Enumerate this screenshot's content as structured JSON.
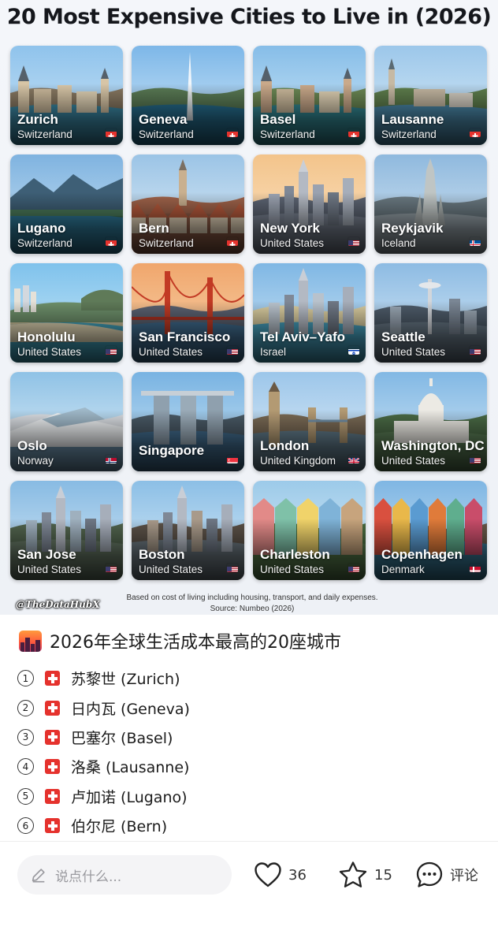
{
  "infographic": {
    "title": "20 Most Expensive Cities to Live in (2026)",
    "watermark": "@TheDataHubX",
    "note_line1": "Based on cost of living including housing, transport, and daily expenses.",
    "note_line2": "Source: Numbeo (2026)",
    "cities": [
      {
        "city": "Zurich",
        "country": "Switzerland",
        "flag": "switzerland-flag-icon"
      },
      {
        "city": "Geneva",
        "country": "Switzerland",
        "flag": "switzerland-flag-icon"
      },
      {
        "city": "Basel",
        "country": "Switzerland",
        "flag": "switzerland-flag-icon"
      },
      {
        "city": "Lausanne",
        "country": "Switzerland",
        "flag": "switzerland-flag-icon"
      },
      {
        "city": "Lugano",
        "country": "Switzerland",
        "flag": "switzerland-flag-icon"
      },
      {
        "city": "Bern",
        "country": "Switzerland",
        "flag": "switzerland-flag-icon"
      },
      {
        "city": "New York",
        "country": "United States",
        "flag": "usa-flag-icon"
      },
      {
        "city": "Reykjavik",
        "country": "Iceland",
        "flag": "iceland-flag-icon"
      },
      {
        "city": "Honolulu",
        "country": "United States",
        "flag": "usa-flag-icon"
      },
      {
        "city": "San Francisco",
        "country": "United States",
        "flag": "usa-flag-icon"
      },
      {
        "city": "Tel Aviv–Yafo",
        "country": "Israel",
        "flag": "israel-flag-icon"
      },
      {
        "city": "Seattle",
        "country": "United States",
        "flag": "usa-flag-icon"
      },
      {
        "city": "Oslo",
        "country": "Norway",
        "flag": "norway-flag-icon"
      },
      {
        "city": "Singapore",
        "country": "",
        "flag": "singapore-flag-icon"
      },
      {
        "city": "London",
        "country": "United Kingdom",
        "flag": "uk-flag-icon"
      },
      {
        "city": "Washington, DC",
        "country": "United States",
        "flag": "usa-flag-icon"
      },
      {
        "city": "San Jose",
        "country": "United States",
        "flag": "usa-flag-icon"
      },
      {
        "city": "Boston",
        "country": "United States",
        "flag": "usa-flag-icon"
      },
      {
        "city": "Charleston",
        "country": "United States",
        "flag": "usa-flag-icon"
      },
      {
        "city": "Copenhagen",
        "country": "Denmark",
        "flag": "denmark-flag-icon"
      }
    ]
  },
  "post": {
    "title_icon": "cityscape-emoji-icon",
    "title": "2026年全球生活成本最高的20座城市",
    "list": [
      {
        "num": "1",
        "text": "苏黎世 (Zurich)"
      },
      {
        "num": "2",
        "text": "日内瓦 (Geneva)"
      },
      {
        "num": "3",
        "text": "巴塞尔 (Basel)"
      },
      {
        "num": "4",
        "text": "洛桑 (Lausanne)"
      },
      {
        "num": "5",
        "text": "卢加诺 (Lugano)"
      },
      {
        "num": "6",
        "text": "伯尔尼 (Bern)"
      }
    ]
  },
  "bottom_bar": {
    "comment_placeholder": "说点什么...",
    "likes": "36",
    "favorites": "15",
    "comment_label": "评论"
  },
  "colors": {
    "swiss_red": "#e5322d",
    "usa_blue": "#3c3b6e",
    "usa_red": "#b22234"
  }
}
